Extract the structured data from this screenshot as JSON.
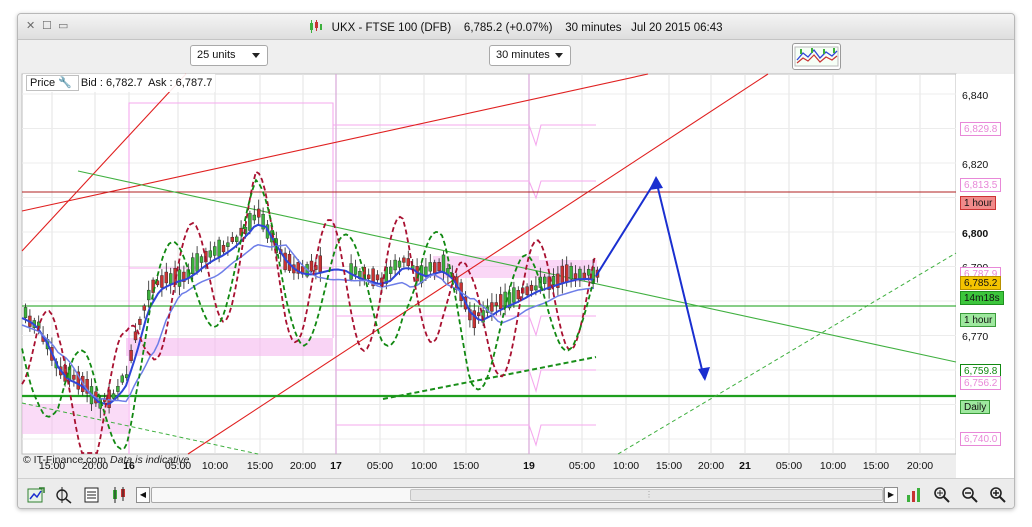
{
  "window": {
    "title": "UKX - FTSE 100 (DFB)    6,785.2 (+0.07%)    30 minutes   Jul 20 2015 06:43",
    "controls": [
      "✕",
      "☐",
      "▭"
    ]
  },
  "toolbar": {
    "units_select": "25 units",
    "interval_select": "30 minutes",
    "indicators_icon": "indicators-icon"
  },
  "price_info": {
    "label": "Price",
    "text": "Bid : 6,782.7  Ask : 6,787.7"
  },
  "credit": {
    "text": "© IT-Finance.com",
    "note": "Data is indicative"
  },
  "y_axis": {
    "ticks": [
      "6,840",
      "6,820",
      "6,800",
      "6,790",
      "6,770",
      "6,750"
    ],
    "tags": [
      {
        "text": "6,829.8",
        "value": 6829.8,
        "bg": "#ffffff",
        "fg": "#e888d8",
        "border": "#e888d8"
      },
      {
        "text": "6,813.5",
        "value": 6813.5,
        "bg": "#ffffff",
        "fg": "#e888d8",
        "border": "#e888d8"
      },
      {
        "text": "1 hour",
        "value": 6808.5,
        "bg": "#f08a8a",
        "fg": "#111111",
        "border": "#cc3333"
      },
      {
        "text": "6,787.9",
        "value": 6787.9,
        "bg": "#ffffff",
        "fg": "#e888d8",
        "border": "#e888d8"
      },
      {
        "text": "6,785.2",
        "value": 6785.2,
        "bg": "#f4c400",
        "fg": "#111111",
        "border": "#b89000"
      },
      {
        "text": "14m18s",
        "value": 6781.0,
        "bg": "#3cc63c",
        "fg": "#111111",
        "border": "#1f8f1f"
      },
      {
        "text": "1 hour",
        "value": 6774.5,
        "bg": "#9ee89e",
        "fg": "#111111",
        "border": "#3a9a3a"
      },
      {
        "text": "6,759.8",
        "value": 6759.8,
        "bg": "#ffffff",
        "fg": "#118811",
        "border": "#118811"
      },
      {
        "text": "6,756.2",
        "value": 6756.2,
        "bg": "#ffffff",
        "fg": "#e888d8",
        "border": "#e888d8"
      },
      {
        "text": "Daily",
        "value": 6749.2,
        "bg": "#9ee89e",
        "fg": "#111111",
        "border": "#3a9a3a"
      },
      {
        "text": "6,740.0",
        "value": 6740.0,
        "bg": "#ffffff",
        "fg": "#e888d8",
        "border": "#e888d8"
      }
    ]
  },
  "x_axis": {
    "labels": [
      {
        "t": "15:00",
        "bold": false
      },
      {
        "t": "20:00",
        "bold": false
      },
      {
        "t": "16",
        "bold": true
      },
      {
        "t": "05:00",
        "bold": false
      },
      {
        "t": "10:00",
        "bold": false
      },
      {
        "t": "15:00",
        "bold": false
      },
      {
        "t": "20:00",
        "bold": false
      },
      {
        "t": "17",
        "bold": true
      },
      {
        "t": "05:00",
        "bold": false
      },
      {
        "t": "10:00",
        "bold": false
      },
      {
        "t": "15:00",
        "bold": false
      },
      {
        "t": "19",
        "bold": true
      },
      {
        "t": "05:00",
        "bold": false
      },
      {
        "t": "10:00",
        "bold": false
      },
      {
        "t": "15:00",
        "bold": false
      },
      {
        "t": "20:00",
        "bold": false
      },
      {
        "t": "21",
        "bold": true
      },
      {
        "t": "05:00",
        "bold": false
      },
      {
        "t": "10:00",
        "bold": false
      },
      {
        "t": "15:00",
        "bold": false
      },
      {
        "t": "20:00",
        "bold": false
      }
    ]
  },
  "colors": {
    "up_candle": "#3cb03c",
    "down_candle": "#c83232",
    "ma_blue": "#2f45d8",
    "trend_red": "#e02020",
    "trend_green": "#40b040",
    "pink": "#f5b7ef",
    "arrow_blue": "#1a2fd0"
  },
  "bottom_toolbar": {
    "icons": [
      "drawing-tools-icon",
      "cursor-settings-icon",
      "chart-type-icon",
      "candlestick-icon",
      "scroll-left-icon",
      "scroll-right-icon",
      "chart-settings-icon",
      "auto-zoom-icon",
      "zoom-out-icon",
      "zoom-in-icon"
    ]
  }
}
